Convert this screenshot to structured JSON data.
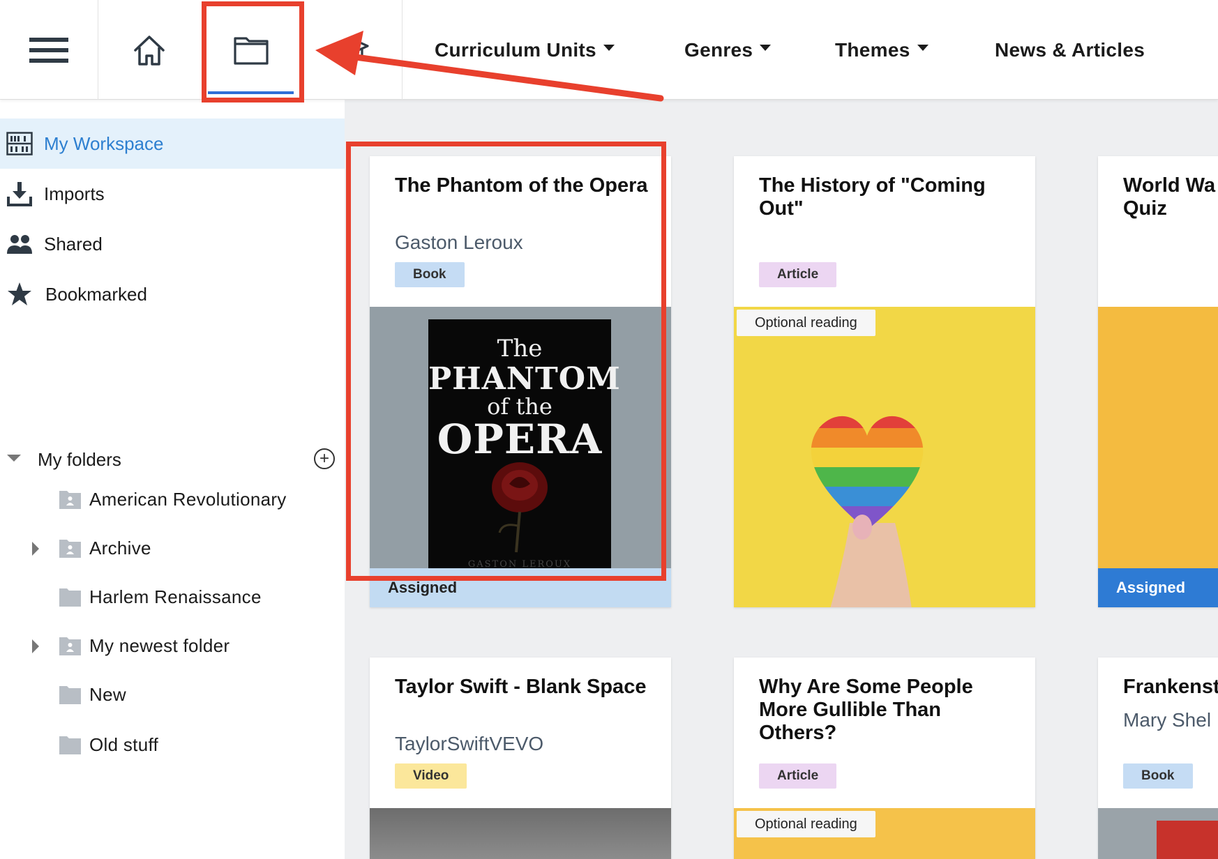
{
  "nav": {
    "menus": [
      {
        "label": "Curriculum Units",
        "dropdown": true
      },
      {
        "label": "Genres",
        "dropdown": true
      },
      {
        "label": "Themes",
        "dropdown": true
      },
      {
        "label": "News & Articles",
        "dropdown": false
      }
    ],
    "icons": [
      "hamburger-icon",
      "home-icon",
      "folder-icon",
      "graduation-cap-icon"
    ],
    "active_tab": "folder",
    "accent": "#2f6fd6"
  },
  "sidebar": {
    "items": [
      {
        "label": "My Workspace",
        "icon": "bookshelf-icon",
        "active": true
      },
      {
        "label": "Imports",
        "icon": "download-icon",
        "active": false
      },
      {
        "label": "Shared",
        "icon": "people-icon",
        "active": false
      },
      {
        "label": "Bookmarked",
        "icon": "star-icon",
        "active": false
      }
    ],
    "folders_label": "My folders",
    "folders": [
      {
        "label": "American Revolutionary",
        "shared": true,
        "expandable": false
      },
      {
        "label": "Archive",
        "shared": true,
        "expandable": true
      },
      {
        "label": "Harlem Renaissance",
        "shared": false,
        "expandable": false
      },
      {
        "label": "My newest folder",
        "shared": true,
        "expandable": true
      },
      {
        "label": "New",
        "shared": false,
        "expandable": false
      },
      {
        "label": "Old stuff",
        "shared": false,
        "expandable": false
      }
    ]
  },
  "cards": [
    {
      "title": "The Phantom of the Opera",
      "author": "Gaston Leroux",
      "type": "Book",
      "status": "Assigned",
      "cover": {
        "line1": "The",
        "line2": "PHANTOM",
        "line3": "of the",
        "line4": "OPERA",
        "footer": "GASTON LEROUX"
      }
    },
    {
      "title": "The History of \"Coming Out\"",
      "author": "",
      "type": "Article",
      "tag": "Optional reading"
    },
    {
      "title": "World War Quiz",
      "title_visible": "World Wa",
      "title_line2": "Quiz",
      "type": "",
      "status": "Assigned"
    },
    {
      "title": "Taylor Swift - Blank Space",
      "author": "TaylorSwiftVEVO",
      "type": "Video"
    },
    {
      "title": "Why Are Some People More Gullible Than Others?",
      "author": "",
      "type": "Article",
      "tag": "Optional reading"
    },
    {
      "title": "Frankenst",
      "author": "Mary Shel",
      "type": "Book"
    }
  ],
  "colors": {
    "annotation_red": "#e8402d",
    "active_blue": "#2d7fd0",
    "assigned_dark": "#2e7bd4",
    "assigned_light": "#c2dbf2"
  }
}
